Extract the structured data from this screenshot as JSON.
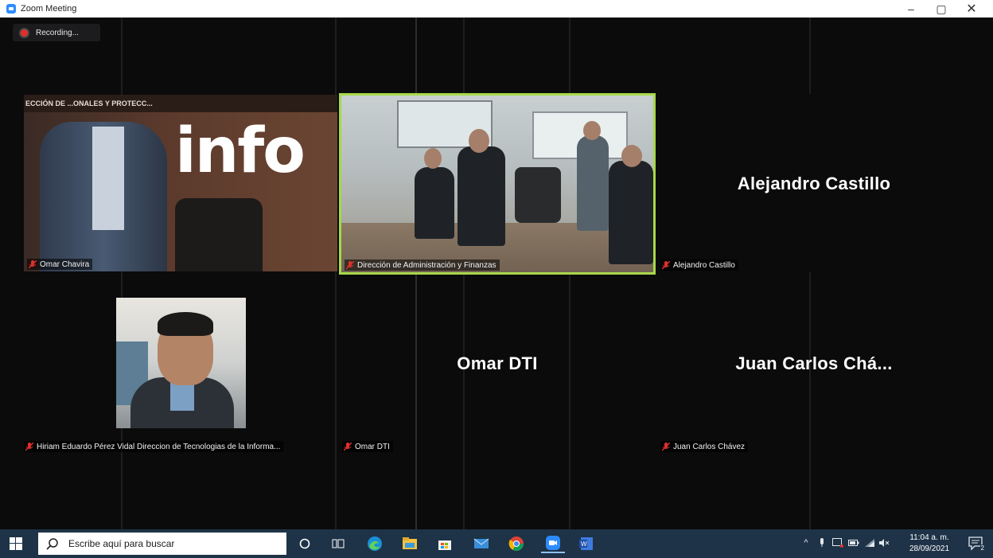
{
  "window": {
    "title": "Zoom Meeting",
    "minimize_symbol": "–",
    "maximize_symbol": "▢",
    "close_symbol": "✕"
  },
  "recording": {
    "label": "Recording..."
  },
  "tiles": [
    {
      "name": "Omar Chavira",
      "video": true,
      "banner_text": "ECCIÓN DE   ...ONALES Y PROTECC...",
      "logo_text": "info"
    },
    {
      "name": "Dirección de Administración y Finanzas",
      "video": true,
      "active_speaker": true
    },
    {
      "name": "Alejandro Castillo",
      "display_name": "Alejandro Castillo",
      "video": false
    },
    {
      "name": "Hiriam Eduardo Pérez Vidal Direccion de Tecnologias de la Informa...",
      "video": false,
      "has_photo": true
    },
    {
      "name": "Omar DTI",
      "display_name": "Omar DTI",
      "video": false
    },
    {
      "name": "Juan Carlos Chávez",
      "display_name": "Juan Carlos Chá...",
      "video": false
    }
  ],
  "taskbar": {
    "search_placeholder": "Escribe aquí para buscar",
    "pinned_apps": [
      "cortana-icon",
      "task-view-icon",
      "edge-icon",
      "file-explorer-icon",
      "microsoft-store-icon",
      "mail-icon",
      "chrome-icon",
      "zoom-icon",
      "word-icon"
    ],
    "active_app": "zoom-icon",
    "clock": {
      "time": "11:04 a. m.",
      "date": "28/09/2021"
    },
    "notification_count": "2"
  },
  "colors": {
    "meeting_bg": "#0b0b0c",
    "active_speaker_border": "#a7d84a",
    "muted_mic": "#e0302b",
    "taskbar_bg": "#1e3347"
  }
}
